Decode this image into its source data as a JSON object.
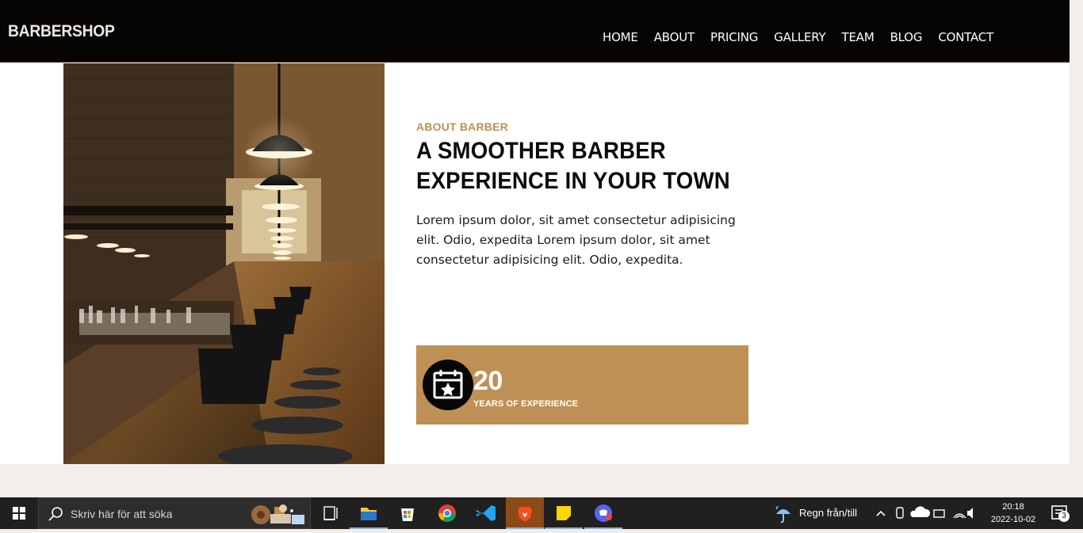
{
  "site": {
    "brand": "BARBERSHOP",
    "nav": [
      "HOME",
      "ABOUT",
      "PRICING",
      "GALLERY",
      "TEAM",
      "BLOG",
      "CONTACT"
    ]
  },
  "about": {
    "eyebrow": "ABOUT BARBER",
    "heading_line1": "A SMOOTHER BARBER",
    "heading_line2": "EXPERIENCE IN YOUR TOWN",
    "body": "Lorem ipsum dolor, sit amet consectetur adipisicing elit. Odio, expedita Lorem ipsum dolor, sit amet consectetur adipisicing elit. Odio, expedita.",
    "stat": {
      "number": "20",
      "label": "YEARS OF EXPERIENCE",
      "icon": "calendar-star-icon"
    }
  },
  "taskbar": {
    "search_placeholder": "Skriv här för att söka",
    "weather_text": "Regn från/till",
    "time": "20:18",
    "date": "2022-10-02",
    "notification_count": "3"
  },
  "colors": {
    "accent": "#bf9055",
    "navbar": "#060504",
    "taskbar": "#202020"
  }
}
